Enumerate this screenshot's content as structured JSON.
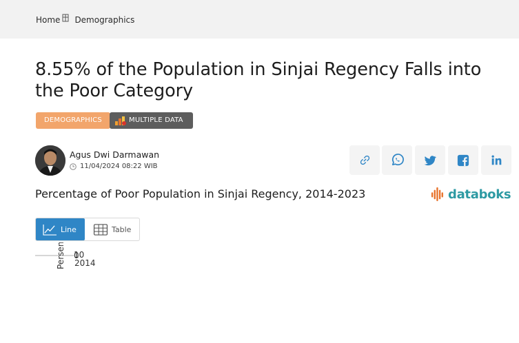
{
  "breadcrumb": {
    "home": "Home",
    "section": "Demographics"
  },
  "article": {
    "title": "8.55% of the Population in Sinjai Regency Falls into the Poor Category",
    "category_tag": "DEMOGRAPHICS",
    "multi_tag": "MULTIPLE DATA",
    "author": "Agus Dwi Darmawan",
    "date": "11/04/2024 08:22 WIB"
  },
  "share": {
    "icons": [
      "link-icon",
      "whatsapp-icon",
      "twitter-icon",
      "facebook-icon",
      "linkedin-icon"
    ]
  },
  "chart": {
    "heading": "Percentage of Poor Population in Sinjai Regency, 2014-2023",
    "brand": "databoks",
    "toggle": {
      "line_label": "Line",
      "table_label": "Table"
    }
  },
  "chart_data": {
    "type": "line",
    "title": "Percentage of Poor Population in Sinjai Regency, 2014-2023",
    "ylabel": "Persen",
    "xlabel": "",
    "y_tick_labels": [
      "10",
      "0"
    ],
    "x_tick_labels": [
      "2014"
    ],
    "ylim": [
      0,
      10
    ],
    "grid": true
  },
  "colors": {
    "accent_blue": "#2f86c6",
    "tag_orange": "#f2a56b",
    "tag_gray": "#5d5d5d",
    "brand_teal": "#2d9aa3",
    "brand_orange": "#e8732c"
  }
}
